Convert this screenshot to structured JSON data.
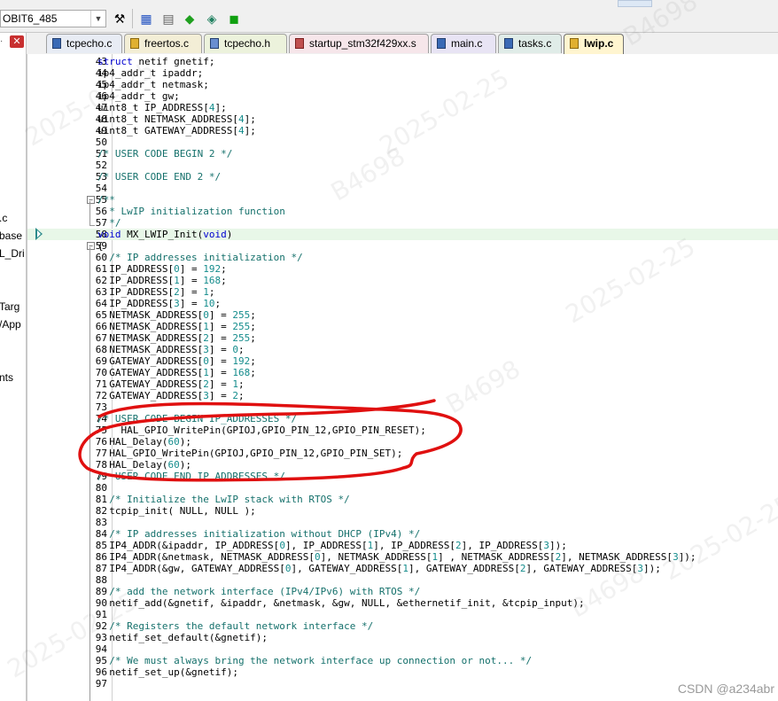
{
  "toolbar": {
    "target_value": "OBIT6_485",
    "icons": [
      "build-target-icon",
      "batch-build-icon",
      "copy-icon",
      "manage-project-icon",
      "pack-installer-icon",
      "component-icon"
    ]
  },
  "left_panel": {
    "fragments": [
      ".c",
      "base",
      "L_Dri",
      "Targ",
      "/App",
      "nts"
    ]
  },
  "tabs": [
    {
      "label": "tcpecho.c",
      "kind": "c"
    },
    {
      "label": "freertos.c",
      "kind": "star"
    },
    {
      "label": "tcpecho.h",
      "kind": "h"
    },
    {
      "label": "startup_stm32f429xx.s",
      "kind": "s"
    },
    {
      "label": "main.c",
      "kind": "c"
    },
    {
      "label": "tasks.c",
      "kind": "c"
    },
    {
      "label": "lwip.c",
      "kind": "star",
      "active": true
    }
  ],
  "code": [
    {
      "n": "43",
      "t": "struct netif gnetif;"
    },
    {
      "n": "44",
      "t": "ip4_addr_t ipaddr;"
    },
    {
      "n": "45",
      "t": "ip4_addr_t netmask;"
    },
    {
      "n": "46",
      "t": "ip4_addr_t gw;"
    },
    {
      "n": "47",
      "t": "uint8_t IP_ADDRESS[4];"
    },
    {
      "n": "48",
      "t": "uint8_t NETMASK_ADDRESS[4];"
    },
    {
      "n": "49",
      "t": "uint8_t GATEWAY_ADDRESS[4];"
    },
    {
      "n": "50",
      "t": ""
    },
    {
      "n": "51",
      "t": "/* USER CODE BEGIN 2 */",
      "c": true
    },
    {
      "n": "52",
      "t": ""
    },
    {
      "n": "53",
      "t": "/* USER CODE END 2 */",
      "c": true
    },
    {
      "n": "54",
      "t": ""
    },
    {
      "n": "55",
      "t": "/**",
      "c": true,
      "fold": "−"
    },
    {
      "n": "56",
      "t": "  * LwIP initialization function",
      "c": true
    },
    {
      "n": "57",
      "t": "  */",
      "c": true
    },
    {
      "n": "58",
      "t": "void MX_LWIP_Init(void)",
      "hl": true
    },
    {
      "n": "59",
      "t": "{",
      "fold": "−"
    },
    {
      "n": "60",
      "t": "  /* IP addresses initialization */",
      "c": true
    },
    {
      "n": "61",
      "t": "  IP_ADDRESS[0] = 192;"
    },
    {
      "n": "62",
      "t": "  IP_ADDRESS[1] = 168;"
    },
    {
      "n": "63",
      "t": "  IP_ADDRESS[2] = 1;"
    },
    {
      "n": "64",
      "t": "  IP_ADDRESS[3] = 10;"
    },
    {
      "n": "65",
      "t": "  NETMASK_ADDRESS[0] = 255;"
    },
    {
      "n": "66",
      "t": "  NETMASK_ADDRESS[1] = 255;"
    },
    {
      "n": "67",
      "t": "  NETMASK_ADDRESS[2] = 255;"
    },
    {
      "n": "68",
      "t": "  NETMASK_ADDRESS[3] = 0;"
    },
    {
      "n": "69",
      "t": "  GATEWAY_ADDRESS[0] = 192;"
    },
    {
      "n": "70",
      "t": "  GATEWAY_ADDRESS[1] = 168;"
    },
    {
      "n": "71",
      "t": "  GATEWAY_ADDRESS[2] = 1;"
    },
    {
      "n": "72",
      "t": "  GATEWAY_ADDRESS[3] = 2;"
    },
    {
      "n": "73",
      "t": ""
    },
    {
      "n": "74",
      "t": "/* USER CODE BEGIN IP_ADDRESSES */",
      "c": true
    },
    {
      "n": "75",
      "t": "    HAL_GPIO_WritePin(GPIOJ,GPIO_PIN_12,GPIO_PIN_RESET);"
    },
    {
      "n": "76",
      "t": "  HAL_Delay(60);"
    },
    {
      "n": "77",
      "t": "  HAL_GPIO_WritePin(GPIOJ,GPIO_PIN_12,GPIO_PIN_SET);"
    },
    {
      "n": "78",
      "t": "  HAL_Delay(60);"
    },
    {
      "n": "79",
      "t": "/* USER CODE END IP_ADDRESSES */",
      "c": true
    },
    {
      "n": "80",
      "t": ""
    },
    {
      "n": "81",
      "t": "  /* Initialize the LwIP stack with RTOS */",
      "c": true
    },
    {
      "n": "82",
      "t": "  tcpip_init( NULL, NULL );"
    },
    {
      "n": "83",
      "t": ""
    },
    {
      "n": "84",
      "t": "  /* IP addresses initialization without DHCP (IPv4) */",
      "c": true
    },
    {
      "n": "85",
      "t": "  IP4_ADDR(&ipaddr, IP_ADDRESS[0], IP_ADDRESS[1], IP_ADDRESS[2], IP_ADDRESS[3]);"
    },
    {
      "n": "86",
      "t": "  IP4_ADDR(&netmask, NETMASK_ADDRESS[0], NETMASK_ADDRESS[1] , NETMASK_ADDRESS[2], NETMASK_ADDRESS[3]);"
    },
    {
      "n": "87",
      "t": "  IP4_ADDR(&gw, GATEWAY_ADDRESS[0], GATEWAY_ADDRESS[1], GATEWAY_ADDRESS[2], GATEWAY_ADDRESS[3]);"
    },
    {
      "n": "88",
      "t": ""
    },
    {
      "n": "89",
      "t": "  /* add the network interface (IPv4/IPv6) with RTOS */",
      "c": true
    },
    {
      "n": "90",
      "t": "  netif_add(&gnetif, &ipaddr, &netmask, &gw, NULL, &ethernetif_init, &tcpip_input);"
    },
    {
      "n": "91",
      "t": ""
    },
    {
      "n": "92",
      "t": "  /* Registers the default network interface */",
      "c": true
    },
    {
      "n": "93",
      "t": "  netif_set_default(&gnetif);"
    },
    {
      "n": "94",
      "t": ""
    },
    {
      "n": "95",
      "t": "  /* We must always bring the network interface up connection or not... */",
      "c": true
    },
    {
      "n": "96",
      "t": "  netif_set_up(&gnetif);"
    },
    {
      "n": "97",
      "t": ""
    }
  ],
  "watermarks": [
    "2025-02-25",
    "B4698",
    "2025-02-25",
    "B4698",
    "2025-02-25",
    "B4698",
    "2025-02-25",
    "B4698",
    "2025-02-25"
  ],
  "footer": {
    "csdn": "CSDN @a234abr"
  },
  "colors": {
    "comment": "#14706b",
    "keyword": "#0000d0",
    "annotation": "#e01010"
  }
}
